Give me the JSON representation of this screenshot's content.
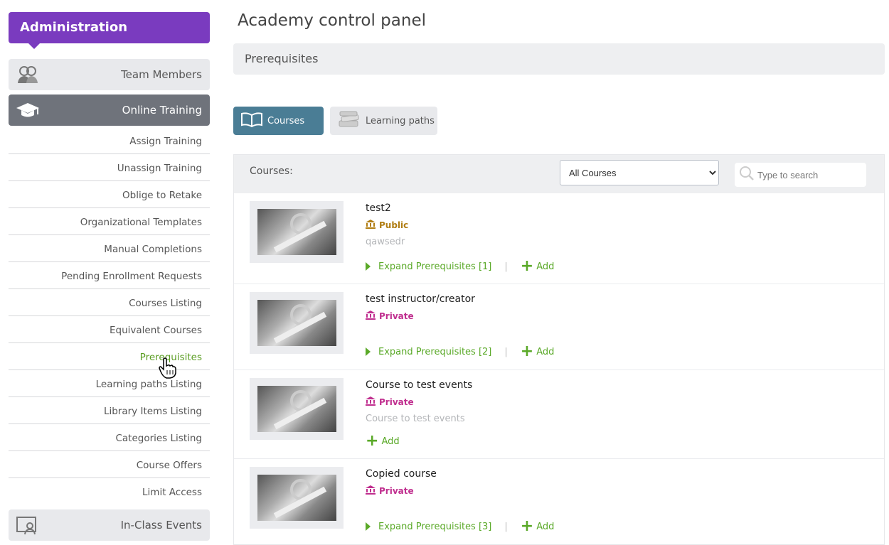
{
  "sidebar": {
    "header": "Administration",
    "team_members": "Team Members",
    "online_training": "Online Training",
    "items": [
      "Assign Training",
      "Unassign Training",
      "Oblige to Retake",
      "Organizational Templates",
      "Manual Completions",
      "Pending Enrollment Requests",
      "Courses Listing",
      "Equivalent Courses",
      "Prerequisites",
      "Learning paths Listing",
      "Library Items Listing",
      "Categories Listing",
      "Course Offers",
      "Limit Access"
    ],
    "active_item": "Prerequisites",
    "in_class_events": "In-Class Events"
  },
  "main": {
    "title": "Academy control panel",
    "section": "Prerequisites",
    "tabs": {
      "courses": "Courses",
      "learning_paths": "Learning paths"
    },
    "courses_label": "Courses:",
    "filter_selected": "All Courses",
    "search_placeholder": "Type to search",
    "add_label": "Add",
    "courses": [
      {
        "title": "test2",
        "visibility": "Public",
        "description": "qawsedr",
        "expand": "Expand Prerequisites [1]"
      },
      {
        "title": "test instructor/creator",
        "visibility": "Private",
        "description": "",
        "expand": "Expand Prerequisites [2]"
      },
      {
        "title": "Course to test events",
        "visibility": "Private",
        "description": "Course to test events",
        "expand": ""
      },
      {
        "title": "Copied course",
        "visibility": "Private",
        "description": "",
        "expand": "Expand Prerequisites [3]"
      }
    ]
  },
  "colors": {
    "admin_purple": "#7a3bbf",
    "active_tab": "#4a7d95",
    "link_green": "#5aa928",
    "public_gold": "#b07d12",
    "private_magenta": "#c02f8f"
  }
}
